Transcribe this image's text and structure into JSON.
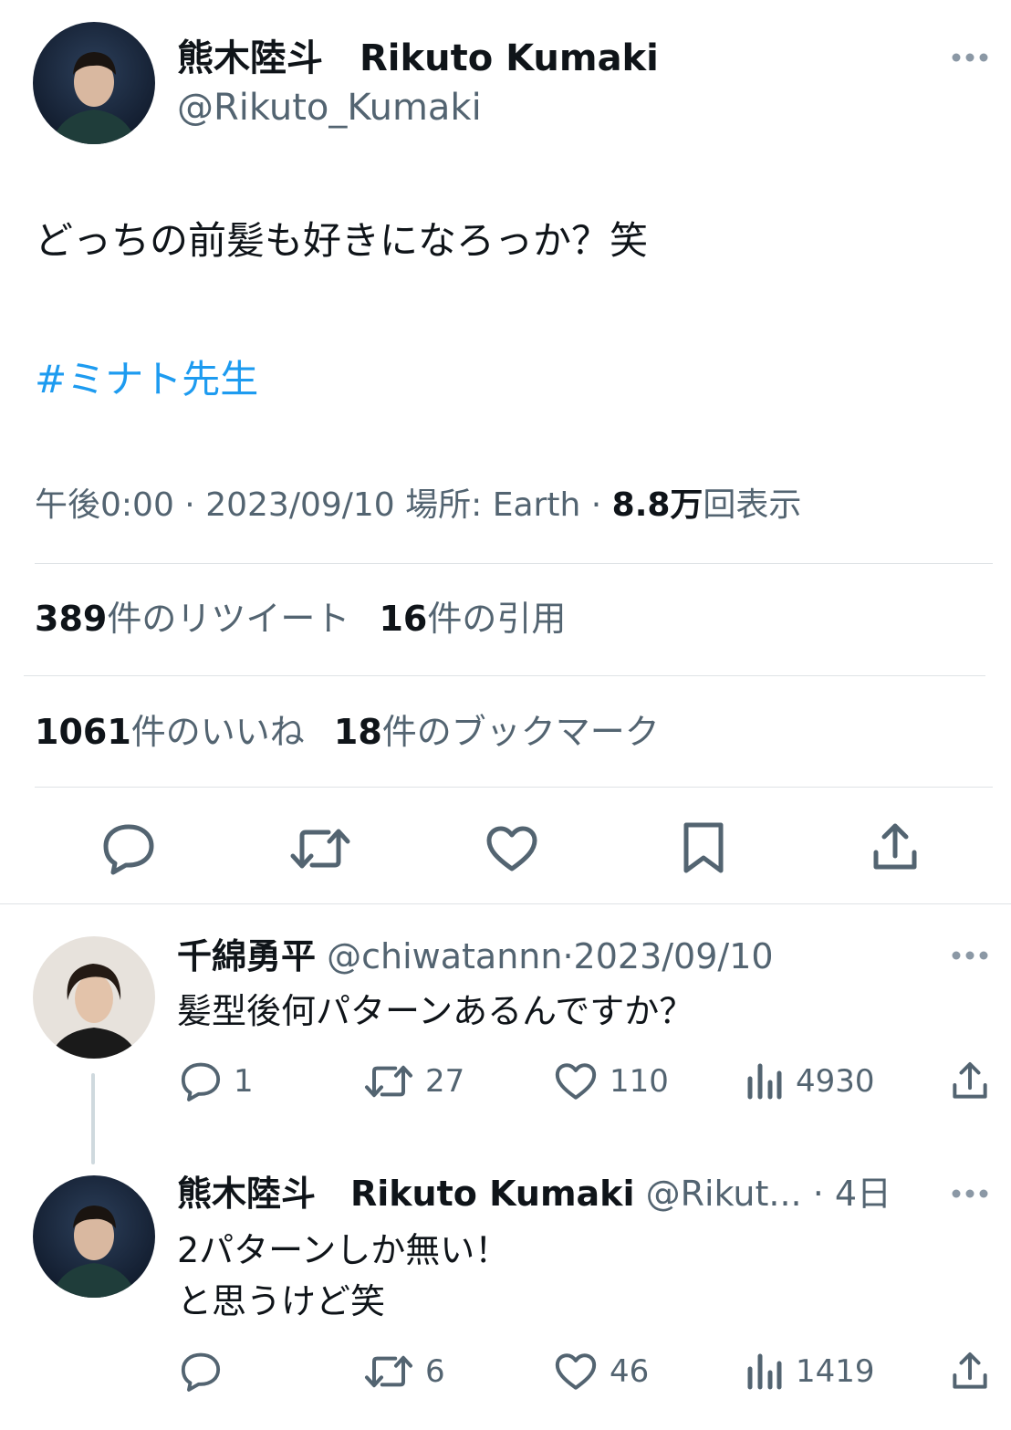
{
  "main_tweet": {
    "display_name": "熊木陸斗　Rikuto Kumaki",
    "handle": "@Rikuto_Kumaki",
    "text": "どっちの前髪も好きになろっか？笑",
    "hashtag": "#ミナト先生",
    "meta": {
      "time": "午後0:00",
      "date": "2023/09/10",
      "location": "場所: Earth",
      "views_count": "8.8万",
      "views_label": "回表示"
    },
    "stats": {
      "retweets_count": "389",
      "retweets_label": "件のリツイート",
      "quotes_count": "16",
      "quotes_label": "件の引用",
      "likes_count": "1061",
      "likes_label": "件のいいね",
      "bookmarks_count": "18",
      "bookmarks_label": "件のブックマーク"
    }
  },
  "replies": [
    {
      "display_name": "千綿勇平",
      "handle": "@chiwatannn",
      "date": "2023/09/10",
      "line1": "髪型後何パターンあるんですか？",
      "line2": "",
      "replies": "1",
      "retweets": "27",
      "likes": "110",
      "views": "4930"
    },
    {
      "display_name": "熊木陸斗　Rikuto Kumaki",
      "handle": "@Rikut...",
      "date": "4日",
      "line1": "2パターンしか無い！",
      "line2": "と思うけど笑",
      "replies": "",
      "retweets": "6",
      "likes": "46",
      "views": "1419"
    }
  ],
  "colors": {
    "text": "#0f1419",
    "secondary": "#536471",
    "hashtag": "#1d9bf0",
    "divider": "#dfe3e6"
  },
  "icons": [
    "more-icon",
    "reply-icon",
    "retweet-icon",
    "like-icon",
    "bookmark-icon",
    "share-icon",
    "views-icon"
  ]
}
